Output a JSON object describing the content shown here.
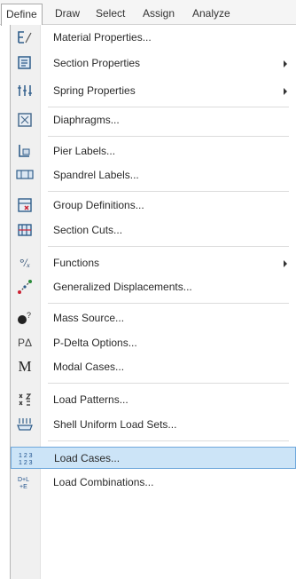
{
  "menubar": {
    "tabs": [
      "Define",
      "Draw",
      "Select",
      "Assign",
      "Analyze"
    ]
  },
  "menu": {
    "items": [
      {
        "label": "Material Properties...",
        "icon": "material-properties-icon",
        "submenu": false
      },
      {
        "label": "Section Properties",
        "icon": "section-properties-icon",
        "submenu": true
      },
      {
        "label": "Spring Properties",
        "icon": "spring-properties-icon",
        "submenu": true
      },
      {
        "label": "Diaphragms...",
        "icon": "diaphragms-icon",
        "submenu": false
      },
      {
        "label": "Pier Labels...",
        "icon": "pier-labels-icon",
        "submenu": false
      },
      {
        "label": "Spandrel Labels...",
        "icon": "spandrel-labels-icon",
        "submenu": false
      },
      {
        "label": "Group Definitions...",
        "icon": "group-definitions-icon",
        "submenu": false
      },
      {
        "label": "Section Cuts...",
        "icon": "section-cuts-icon",
        "submenu": false
      },
      {
        "label": "Functions",
        "icon": "functions-icon",
        "submenu": true
      },
      {
        "label": "Generalized Displacements...",
        "icon": "generalized-displacements-icon",
        "submenu": false
      },
      {
        "label": "Mass Source...",
        "icon": "mass-source-icon",
        "submenu": false
      },
      {
        "label": "P-Delta Options...",
        "icon": "p-delta-icon",
        "submenu": false
      },
      {
        "label": "Modal Cases...",
        "icon": "modal-cases-icon",
        "submenu": false
      },
      {
        "label": "Load Patterns...",
        "icon": "load-patterns-icon",
        "submenu": false
      },
      {
        "label": "Shell Uniform Load Sets...",
        "icon": "shell-uniform-load-sets-icon",
        "submenu": false
      },
      {
        "label": "Load Cases...",
        "icon": "load-cases-icon",
        "submenu": false,
        "highlighted": true
      },
      {
        "label": "Load Combinations...",
        "icon": "load-combinations-icon",
        "submenu": false
      }
    ],
    "icon_glyphs": {
      "p-delta-icon": "PΔ",
      "modal-cases-icon": "M",
      "functions-icon": "°/ₓ"
    },
    "colors": {
      "highlight_bg": "#cce4f7",
      "highlight_border": "#6fa8dc"
    }
  }
}
